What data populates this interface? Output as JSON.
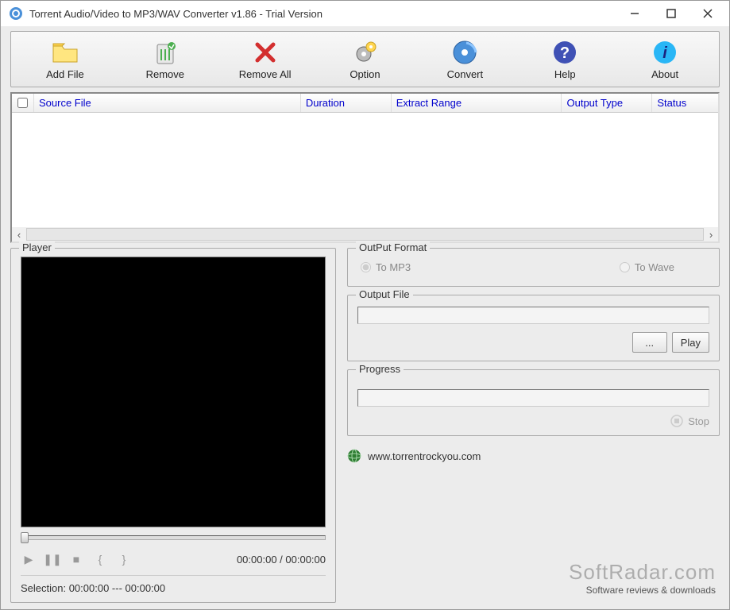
{
  "window": {
    "title": "Torrent Audio/Video to MP3/WAV Converter v1.86 - Trial Version"
  },
  "toolbar": [
    {
      "name": "add-file",
      "label": "Add File"
    },
    {
      "name": "remove",
      "label": "Remove"
    },
    {
      "name": "remove-all",
      "label": "Remove All"
    },
    {
      "name": "option",
      "label": "Option"
    },
    {
      "name": "convert",
      "label": "Convert"
    },
    {
      "name": "help",
      "label": "Help"
    },
    {
      "name": "about",
      "label": "About"
    }
  ],
  "columns": {
    "source": "Source File",
    "duration": "Duration",
    "range": "Extract Range",
    "output_type": "Output Type",
    "status": "Status"
  },
  "player": {
    "legend": "Player",
    "time": "00:00:00 / 00:00:00",
    "selection": "Selection: 00:00:00 --- 00:00:00"
  },
  "output_format": {
    "legend": "OutPut Format",
    "mp3": "To MP3",
    "wave": "To Wave"
  },
  "output_file": {
    "legend": "Output File",
    "browse": "...",
    "play": "Play"
  },
  "progress": {
    "legend": "Progress",
    "stop": "Stop"
  },
  "footer": {
    "url": "www.torrentrockyou.com"
  },
  "watermark": {
    "main": "SoftRadar.com",
    "sub": "Software reviews & downloads"
  }
}
